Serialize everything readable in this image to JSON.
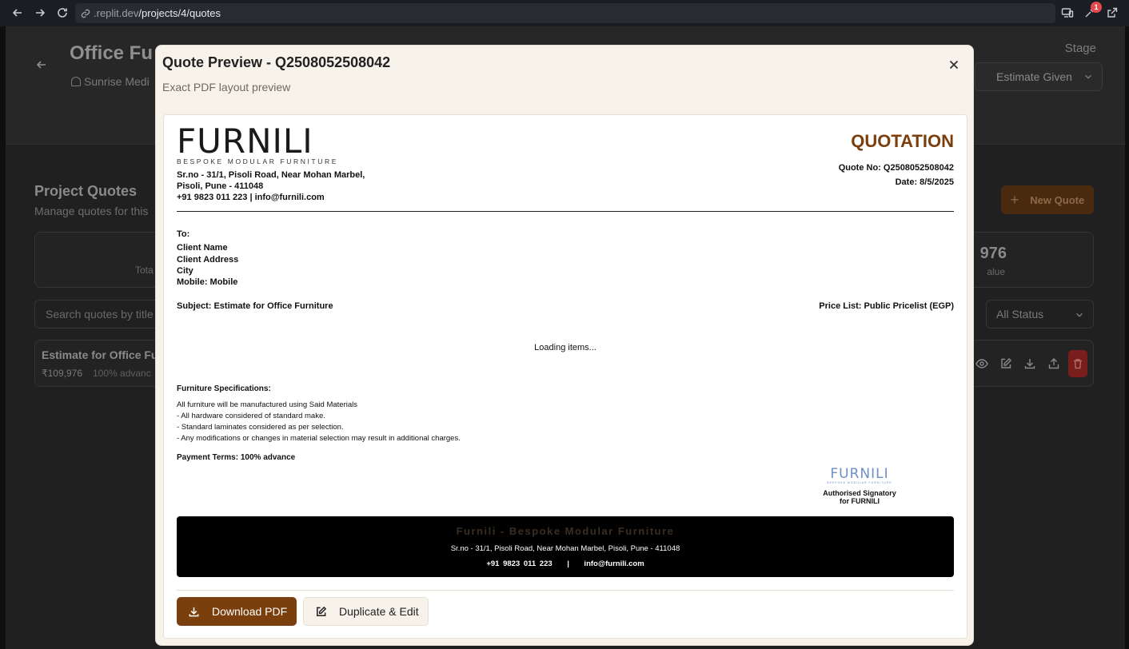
{
  "browser": {
    "url_host": ".replit.dev",
    "url_path": "/projects/4/quotes",
    "notification_count": "1"
  },
  "background": {
    "project_title": "Office Fu",
    "client_name": "Sunrise Medi",
    "stage_label": "Stage",
    "stage_value": "Estimate Given",
    "section_title": "Project Quotes",
    "section_subtitle": "Manage quotes for this",
    "new_quote_label": "New Quote",
    "stat_left_label": "Tota",
    "stat_right_value": "976",
    "stat_right_label": "alue",
    "search_placeholder": "Search quotes by title",
    "status_filter": "All Status",
    "quote_row": {
      "title": "Estimate for Office Fu",
      "amount": "₹109,976",
      "terms": "100% advanc"
    }
  },
  "modal": {
    "title": "Quote Preview - Q2508052508042",
    "subtitle": "Exact PDF layout preview",
    "close_icon": "close-icon",
    "document": {
      "logo_word": "FURNILI",
      "logo_tagline": "BESPOKE MODULAR FURNITURE",
      "address_line1": "Sr.no - 31/1, Pisoli Road, Near Mohan Marbel,",
      "address_line2": "Pisoli, Pune - 411048",
      "address_line3": "+91 9823 011 223 | info@furnili.com",
      "doc_type": "QUOTATION",
      "quote_no": "Quote No: Q2508052508042",
      "date": "Date: 8/5/2025",
      "to_label": "To:",
      "client_name": "Client Name",
      "client_address": "Client Address",
      "city": "City",
      "mobile": "Mobile: Mobile",
      "subject": "Subject: Estimate for Office Furniture",
      "price_list": "Price List: Public Pricelist (EGP)",
      "loading": "Loading items...",
      "spec_title": "Furniture Specifications:",
      "spec_lines": [
        "All furniture will be manufactured using Said Materials",
        "- All hardware considered of standard make.",
        "- Standard laminates considered as per selection.",
        "- Any modifications or changes in material selection may result in additional charges."
      ],
      "payment_terms": "Payment Terms: 100% advance",
      "sign_logo": "FURNILI",
      "sign_tagline": "BESPOKE MODULAR FURNITURE",
      "sign_line1": "Authorised Signatory",
      "sign_line2": "for FURNILI",
      "footer_brand": "Furnili - Bespoke Modular Furniture",
      "footer_address": "Sr.no - 31/1, Pisoli Road, Near Mohan Marbel, Pisoli, Pune - 411048",
      "footer_contact": "+91 9823 011 223    |    info@furnili.com"
    },
    "download_label": "Download PDF",
    "duplicate_label": "Duplicate & Edit"
  },
  "colors": {
    "accent_brown": "#7a3f0d",
    "modal_bg": "#f7f2ea",
    "footer_bg": "#000000",
    "signature_blue": "#6f8fc7"
  }
}
